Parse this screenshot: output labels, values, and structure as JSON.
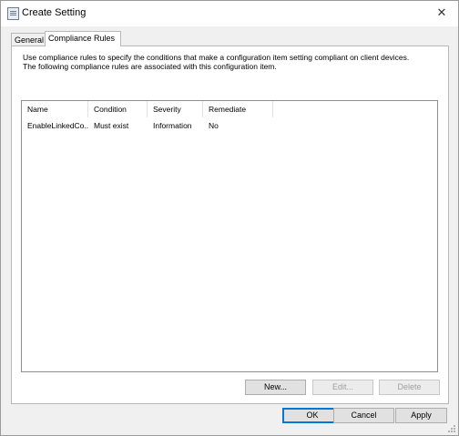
{
  "window": {
    "title": "Create Setting",
    "close_glyph": "✕"
  },
  "tabs": [
    {
      "label": "General",
      "selected": false
    },
    {
      "label": "Compliance Rules",
      "selected": true
    }
  ],
  "description": "Use compliance rules to specify the conditions that make a configuration item setting compliant on client devices. The following compliance rules are associated with this configuration item.",
  "list": {
    "columns": [
      "Name",
      "Condition",
      "Severity",
      "Remediate"
    ],
    "rows": [
      [
        "EnableLinkedCo...",
        "Must exist",
        "Information",
        "No"
      ]
    ]
  },
  "rule_buttons": {
    "new": "New...",
    "edit": "Edit...",
    "delete": "Delete"
  },
  "dialog_buttons": {
    "ok": "OK",
    "cancel": "Cancel",
    "apply": "Apply"
  },
  "icons": {
    "app": "settings-dialog-icon",
    "close": "close-icon",
    "resize": "resize-grip-icon"
  }
}
